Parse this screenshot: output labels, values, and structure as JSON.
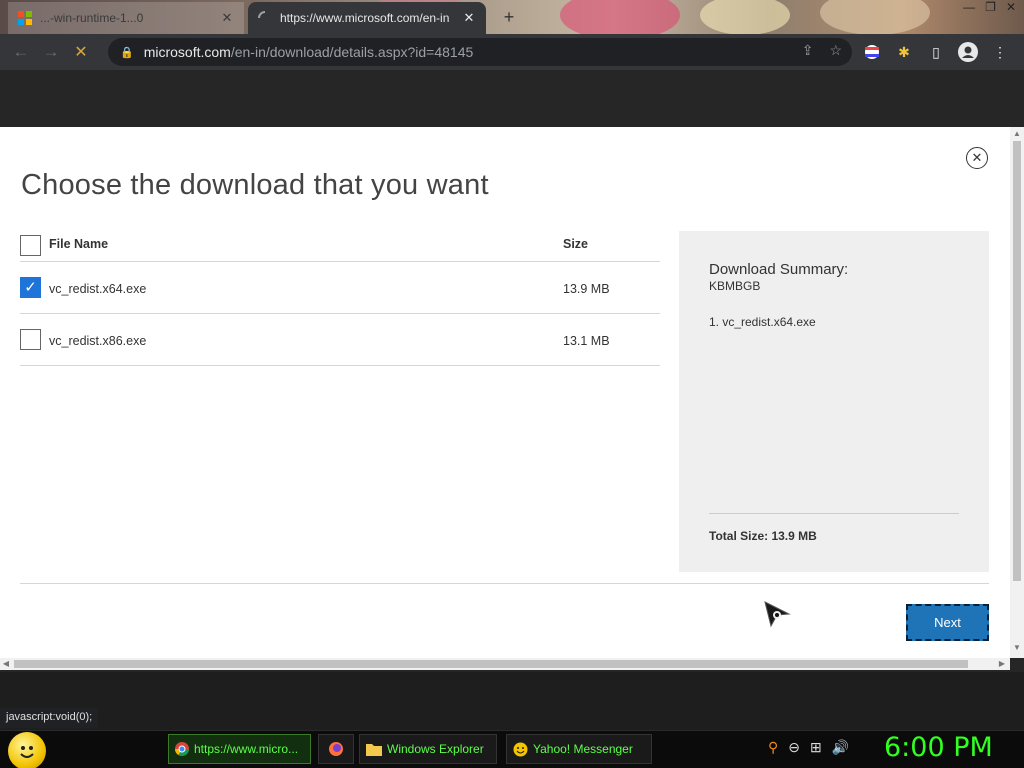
{
  "browser": {
    "tabs": [
      {
        "title": "...-win-runtime-1...0",
        "active": false
      },
      {
        "title": "https://www.microsoft.com/en-in",
        "active": true
      }
    ],
    "url_host": "microsoft.com",
    "url_path": "/en-in/download/details.aspx?id=48145",
    "status_url": "javascript:void(0);"
  },
  "dialog": {
    "title": "Choose the download that you want",
    "table": {
      "headers": {
        "name": "File Name",
        "size": "Size"
      },
      "rows": [
        {
          "name": "vc_redist.x64.exe",
          "size": "13.9 MB",
          "checked": true
        },
        {
          "name": "vc_redist.x86.exe",
          "size": "13.1 MB",
          "checked": false
        }
      ]
    },
    "summary": {
      "heading": "Download Summary:",
      "code": "KBMBGB",
      "items": [
        "1. vc_redist.x64.exe"
      ],
      "total": "Total Size: 13.9 MB"
    },
    "next_label": "Next"
  },
  "taskbar": {
    "items": [
      {
        "label": "https://www.micro...",
        "icon": "chrome-icon"
      },
      {
        "label": "",
        "icon": "firefox-icon"
      },
      {
        "label": "Windows Explorer",
        "icon": "folder-icon"
      },
      {
        "label": "Yahoo! Messenger",
        "icon": "yahoo-messenger-icon"
      }
    ],
    "clock": "6:00 PM"
  },
  "colors": {
    "accent": "#1f74b8",
    "checkbox": "#1f74d9",
    "taskbar_text": "#5dff4a",
    "clock": "#31ff1f"
  }
}
